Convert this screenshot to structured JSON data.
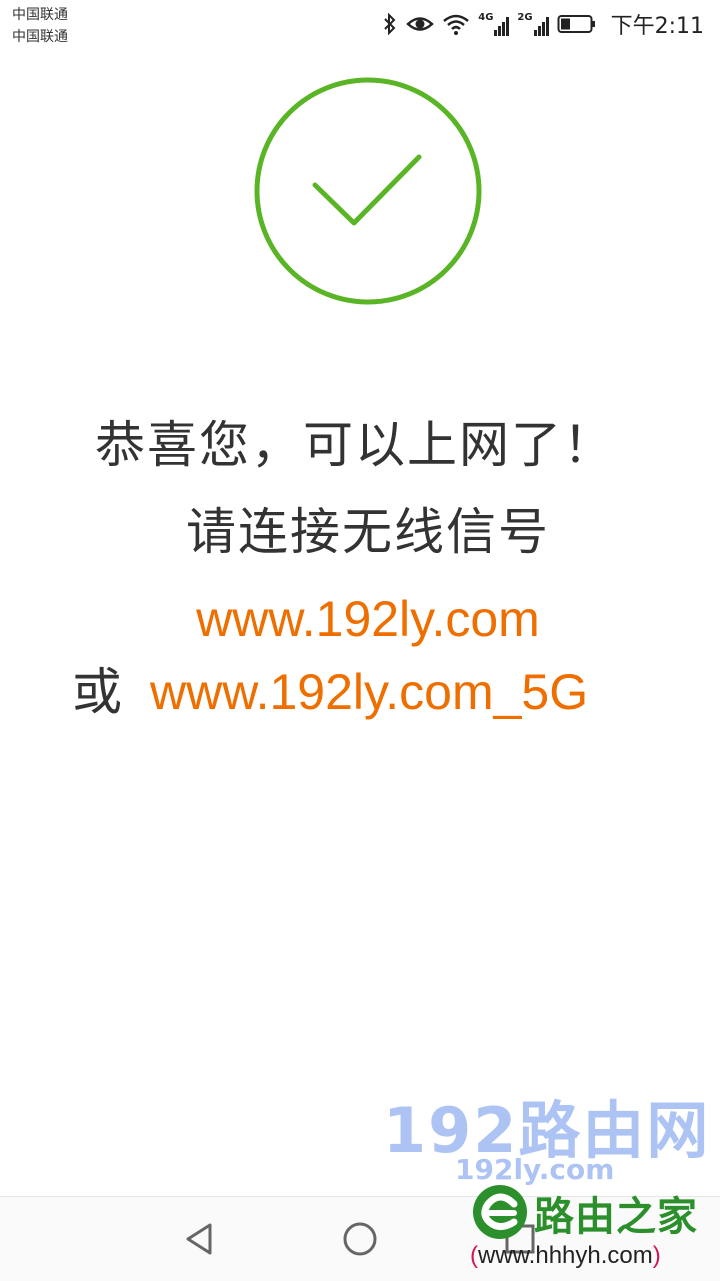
{
  "status_bar": {
    "carrier_1": "中国联通",
    "carrier_2": "中国联通",
    "net_4g": "4G",
    "net_2g": "2G",
    "time": "下午2:11"
  },
  "main": {
    "title": "恭喜您，可以上网了！",
    "subtitle": "请连接无线信号",
    "ssid_primary": "www.192ly.com",
    "or_label": "或",
    "ssid_5g": "www.192ly.com_5G"
  },
  "watermark": {
    "brand_cn": "192路由网",
    "brand_url": "192ly.com",
    "brand2_name": "路由之家",
    "brand2_url_open": "(",
    "brand2_url": "www.hhhyh.com",
    "brand2_url_close": ")"
  },
  "colors": {
    "success_green": "#5ab526",
    "ssid_orange": "#ee6f00",
    "text_dark": "#333333"
  },
  "icons": [
    "bluetooth-icon",
    "eye-icon",
    "wifi-icon",
    "signal-icon",
    "battery-icon",
    "success-check-icon",
    "back-icon",
    "home-icon",
    "recents-icon"
  ]
}
